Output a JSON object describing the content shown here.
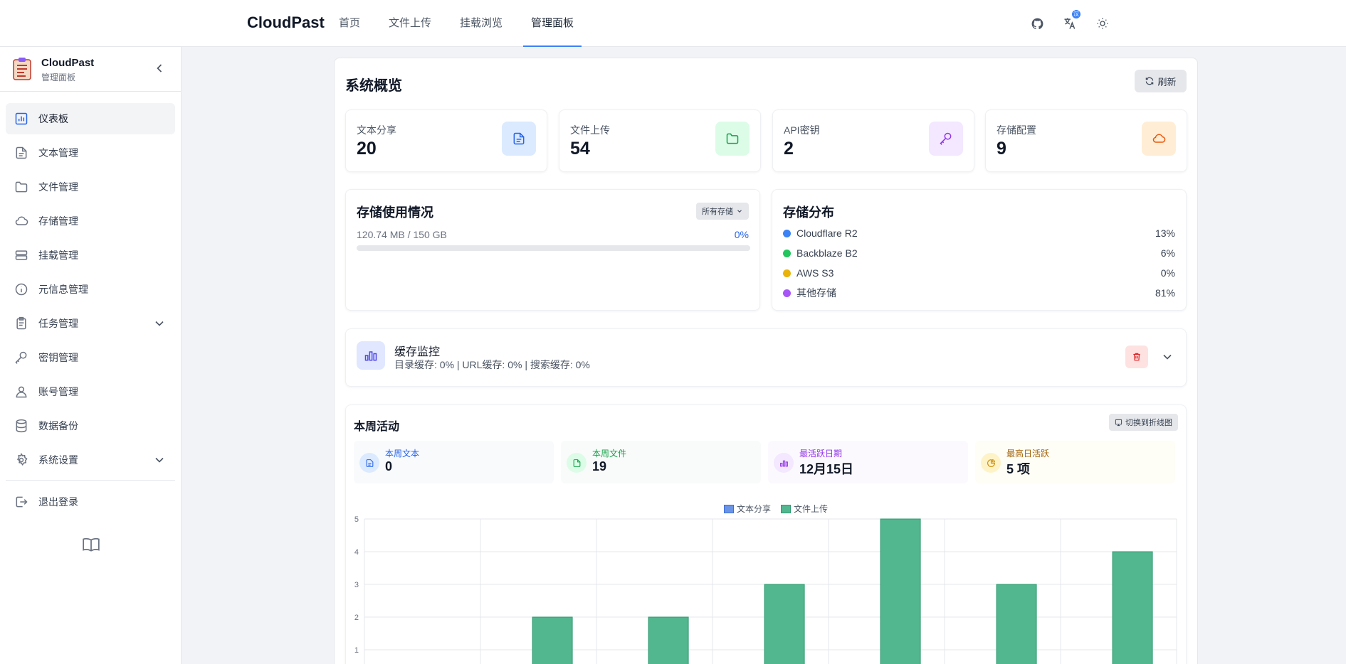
{
  "topbar": {
    "brand": "CloudPast",
    "nav": [
      "首页",
      "文件上传",
      "挂载浏览",
      "管理面板"
    ],
    "active_nav": "管理面板",
    "icons": [
      "github-icon",
      "translate-icon",
      "sun-icon"
    ]
  },
  "sidebar": {
    "title": "CloudPast",
    "subtitle": "管理面板",
    "items": [
      {
        "label": "仪表板",
        "icon": "dashboard-icon",
        "active": true
      },
      {
        "label": "文本管理",
        "icon": "document-icon"
      },
      {
        "label": "文件管理",
        "icon": "folder-icon"
      },
      {
        "label": "存储管理",
        "icon": "cloud-icon"
      },
      {
        "label": "挂载管理",
        "icon": "drive-icon"
      },
      {
        "label": "元信息管理",
        "icon": "info-icon"
      },
      {
        "label": "任务管理",
        "icon": "clipboard-icon",
        "expandable": true
      },
      {
        "label": "密钥管理",
        "icon": "key-icon"
      },
      {
        "label": "账号管理",
        "icon": "user-icon"
      },
      {
        "label": "数据备份",
        "icon": "database-icon"
      },
      {
        "label": "系统设置",
        "icon": "gear-icon",
        "expandable": true
      }
    ],
    "logout": "退出登录"
  },
  "overview": {
    "title": "系统概览",
    "refresh_label": "刷新",
    "stats": [
      {
        "label": "文本分享",
        "value": "20",
        "icon": "document-icon",
        "color": "#2563eb",
        "bg": "#dbeafe"
      },
      {
        "label": "文件上传",
        "value": "54",
        "icon": "folder-icon",
        "color": "#16a34a",
        "bg": "#dcfce7"
      },
      {
        "label": "API密钥",
        "value": "2",
        "icon": "key-icon",
        "color": "#9333ea",
        "bg": "#f3e8ff"
      },
      {
        "label": "存储配置",
        "value": "9",
        "icon": "cloud-icon",
        "color": "#ea580c",
        "bg": "#ffedd5"
      }
    ]
  },
  "storage_usage": {
    "title": "存储使用情况",
    "selector": "所有存储",
    "usage_text": "120.74 MB / 150 GB",
    "percent_text": "0%",
    "percent": 0
  },
  "storage_dist": {
    "title": "存储分布",
    "rows": [
      {
        "name": "Cloudflare R2",
        "pct": "13%",
        "color": "#3b82f6"
      },
      {
        "name": "Backblaze B2",
        "pct": "6%",
        "color": "#22c55e"
      },
      {
        "name": "AWS S3",
        "pct": "0%",
        "color": "#eab308"
      },
      {
        "name": "其他存储",
        "pct": "81%",
        "color": "#a855f7"
      }
    ]
  },
  "cache": {
    "title": "缓存监控",
    "subtitle": "目录缓存: 0% | URL缓存: 0% | 搜索缓存: 0%"
  },
  "activity": {
    "title": "本周活动",
    "toggle_label": "切换到折线图",
    "minis": [
      {
        "label": "本周文本",
        "value": "0",
        "label_color": "#2563eb",
        "bg": "#f8fafc",
        "icon_bg": "#dbeafe",
        "icon_color": "#2563eb",
        "icon": "document-icon"
      },
      {
        "label": "本周文件",
        "value": "19",
        "label_color": "#16a34a",
        "bg": "#f8fbf9",
        "icon_bg": "#dcfce7",
        "icon_color": "#16a34a",
        "icon": "file-icon"
      },
      {
        "label": "最活跃日期",
        "value": "12月15日",
        "label_color": "#9333ea",
        "bg": "#fbf9fd",
        "icon_bg": "#f3e8ff",
        "icon_color": "#9333ea",
        "icon": "chart-icon"
      },
      {
        "label": "最高日活跃",
        "value": "5 项",
        "label_color": "#a16207",
        "bg": "#fefdf6",
        "icon_bg": "#fef3c7",
        "icon_color": "#ca8a04",
        "icon": "pie-icon"
      }
    ],
    "chart_data": {
      "type": "bar",
      "categories": [
        "",
        "",
        "",
        "",
        "",
        "",
        ""
      ],
      "series": [
        {
          "name": "文本分享",
          "values": [
            0,
            0,
            0,
            0,
            0,
            0,
            0
          ],
          "color": "#6b93e6"
        },
        {
          "name": "文件上传",
          "values": [
            0,
            2,
            2,
            3,
            5,
            3,
            4
          ],
          "color": "#52b68f"
        }
      ],
      "ylim": [
        0,
        5
      ],
      "yticks": [
        "1",
        "2",
        "3",
        "4",
        "5"
      ],
      "grid": true,
      "legend": "top-center"
    }
  }
}
